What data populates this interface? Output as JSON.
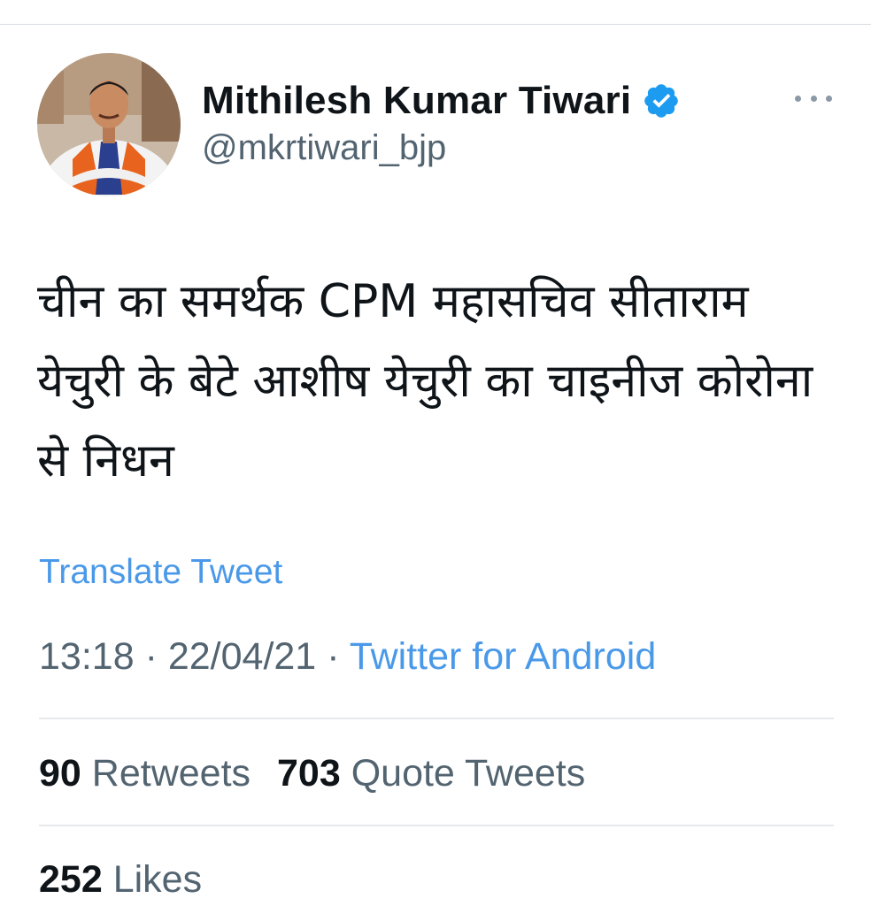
{
  "tweet": {
    "author": {
      "display_name": "Mithilesh Kumar Tiwari",
      "handle": "@mkrtiwari_bjp",
      "verified_icon": "verified-badge-icon",
      "avatar_icon": "profile-avatar"
    },
    "text": "चीन का समर्थक CPM महासचिव सीताराम येचुरी के बेटे आशीष येचुरी का चाइनीज कोरोना से निधन",
    "translate_label": "Translate Tweet",
    "time": "13:18",
    "separator": "·",
    "date": "22/04/21",
    "source": "Twitter for Android",
    "more_icon": "more-horizontal-icon"
  },
  "stats": {
    "retweets": {
      "count": "90",
      "label": "Retweets"
    },
    "quote_tweets": {
      "count": "703",
      "label": "Quote Tweets"
    },
    "likes": {
      "count": "252",
      "label": "Likes"
    }
  },
  "colors": {
    "link": "#4a99e9",
    "verified": "#1d9bf0",
    "secondary_text": "#536471",
    "primary_text": "#0f1419",
    "divider": "#e6e9ec"
  }
}
